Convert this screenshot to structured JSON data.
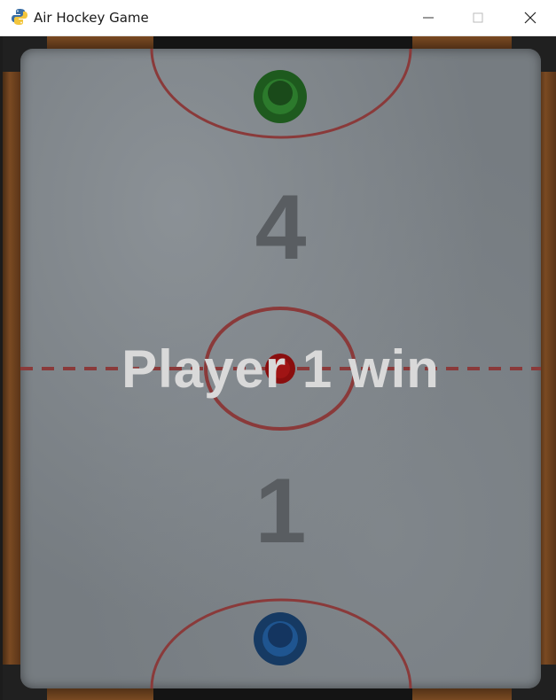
{
  "window": {
    "title": "Air Hockey Game",
    "icon": "python-icon",
    "controls": [
      "minimize-icon",
      "maximize-icon",
      "close-icon"
    ]
  },
  "game": {
    "score_top": "4",
    "score_bottom": "1",
    "message": "Player 1 win",
    "colors": {
      "table": "#767c81",
      "lines": "#8a3a3a",
      "top_mallet": "#1e5a1e",
      "bottom_mallet": "#1c4a7a",
      "puck": "#8a0e0e",
      "score_text": "#595d61",
      "message_text": "#d9d9d9"
    }
  }
}
